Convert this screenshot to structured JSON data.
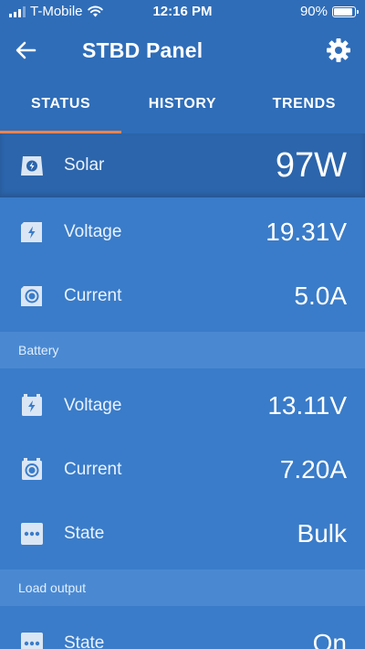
{
  "status_bar": {
    "carrier": "T-Mobile",
    "time": "12:16 PM",
    "battery": "90%"
  },
  "header": {
    "title": "STBD Panel"
  },
  "tabs": [
    {
      "label": "STATUS",
      "active": true
    },
    {
      "label": "HISTORY",
      "active": false
    },
    {
      "label": "TRENDS",
      "active": false
    }
  ],
  "solar": {
    "label": "Solar",
    "value": "97W",
    "icon": "solar-panel-icon"
  },
  "pv": {
    "voltage": {
      "label": "Voltage",
      "value": "19.31V",
      "icon": "lightning-icon"
    },
    "current": {
      "label": "Current",
      "value": "5.0A",
      "icon": "current-icon"
    }
  },
  "battery_section": {
    "title": "Battery",
    "voltage": {
      "label": "Voltage",
      "value": "13.11V",
      "icon": "battery-lightning-icon"
    },
    "current": {
      "label": "Current",
      "value": "7.20A",
      "icon": "battery-current-icon"
    },
    "state": {
      "label": "State",
      "value": "Bulk",
      "icon": "dots-icon"
    }
  },
  "load_section": {
    "title": "Load output",
    "state": {
      "label": "State",
      "value": "On",
      "icon": "dots-icon"
    }
  },
  "colors": {
    "primary": "#2f6db8",
    "background": "#3a7cc9",
    "tab_indicator": "#f0824a",
    "section_bg": "#4a89d2"
  }
}
